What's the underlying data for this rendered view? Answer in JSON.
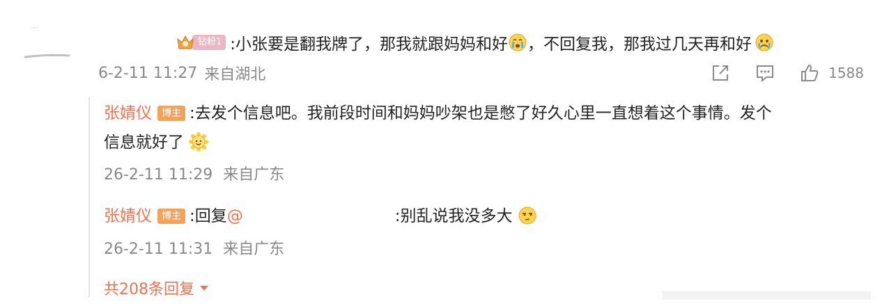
{
  "comment": {
    "fan_badge": "钻粉1",
    "text_part1": ":小张要是翻我牌了，那我就跟妈妈和好",
    "text_part2": "，不回复我，那我过几天再和好",
    "emoji1": "crying-emoji",
    "emoji2": "tearful-emoji",
    "time": "6-2-11 11:27",
    "location": "来自湖北",
    "like_count": "1588"
  },
  "replies": [
    {
      "author": "张婧仪",
      "badge": "博主",
      "text": ":去发个信息吧。我前段时间和妈妈吵架也是憋了好久心里一直想着这个事情。发个",
      "text2": "信息就好了",
      "emoji": "sun-smile-emoji",
      "time": "26-2-11 11:29",
      "location": "来自广东"
    },
    {
      "author": "张婧仪",
      "badge": "博主",
      "reply_prefix": ":回复",
      "mention": "@",
      "text": ":别乱说我没多大",
      "emoji": "thinking-emoji",
      "time": "26-2-11 11:31",
      "location": "来自广东"
    }
  ],
  "more_replies": "共208条回复",
  "colors": {
    "accent": "#eb7350",
    "meta": "#888888",
    "host_badge": "#f3a257",
    "fan_badge": "#e9b7c6"
  }
}
